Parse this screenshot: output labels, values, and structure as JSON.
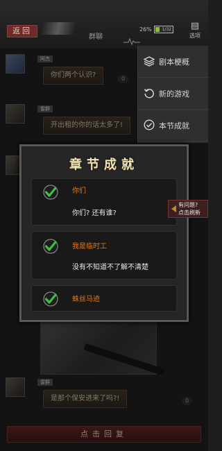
{
  "topbar": {
    "back_label": "返回",
    "title": "群聊",
    "battery_percent_text": "26%",
    "battery_value": 0.26,
    "battery_label": "1/32",
    "menu_label": "选项"
  },
  "messages": [
    {
      "sender": "阿杰",
      "text": "你们两个认识?",
      "count": "0"
    },
    {
      "sender": "雷群",
      "text": "开出租的你的话太多了!"
    },
    {
      "sender": "雷群",
      "text": "是那个保安进来了吗?!",
      "count": "0"
    }
  ],
  "dropdown": {
    "items": [
      {
        "label": "剧本梗概",
        "icon": "layers-icon"
      },
      {
        "label": "新的游戏",
        "icon": "restart-icon"
      },
      {
        "label": "本节成就",
        "icon": "check-circle-icon"
      }
    ]
  },
  "panel": {
    "title": "章节成就",
    "achievements": [
      {
        "title": "你们",
        "desc": "你们? 还有谁?"
      },
      {
        "title": "我是临时工",
        "desc": "没有不知道不了解不清楚"
      },
      {
        "title": "蛛丝马迹",
        "desc": ""
      }
    ]
  },
  "side_tab": {
    "line1": "有问题?",
    "line2": "点击刷新"
  },
  "reply_bar": {
    "label": "点击回复"
  },
  "colors": {
    "accent_orange": "#e07a16",
    "check_green": "#3fbf3f",
    "button_red": "#5a2424"
  }
}
